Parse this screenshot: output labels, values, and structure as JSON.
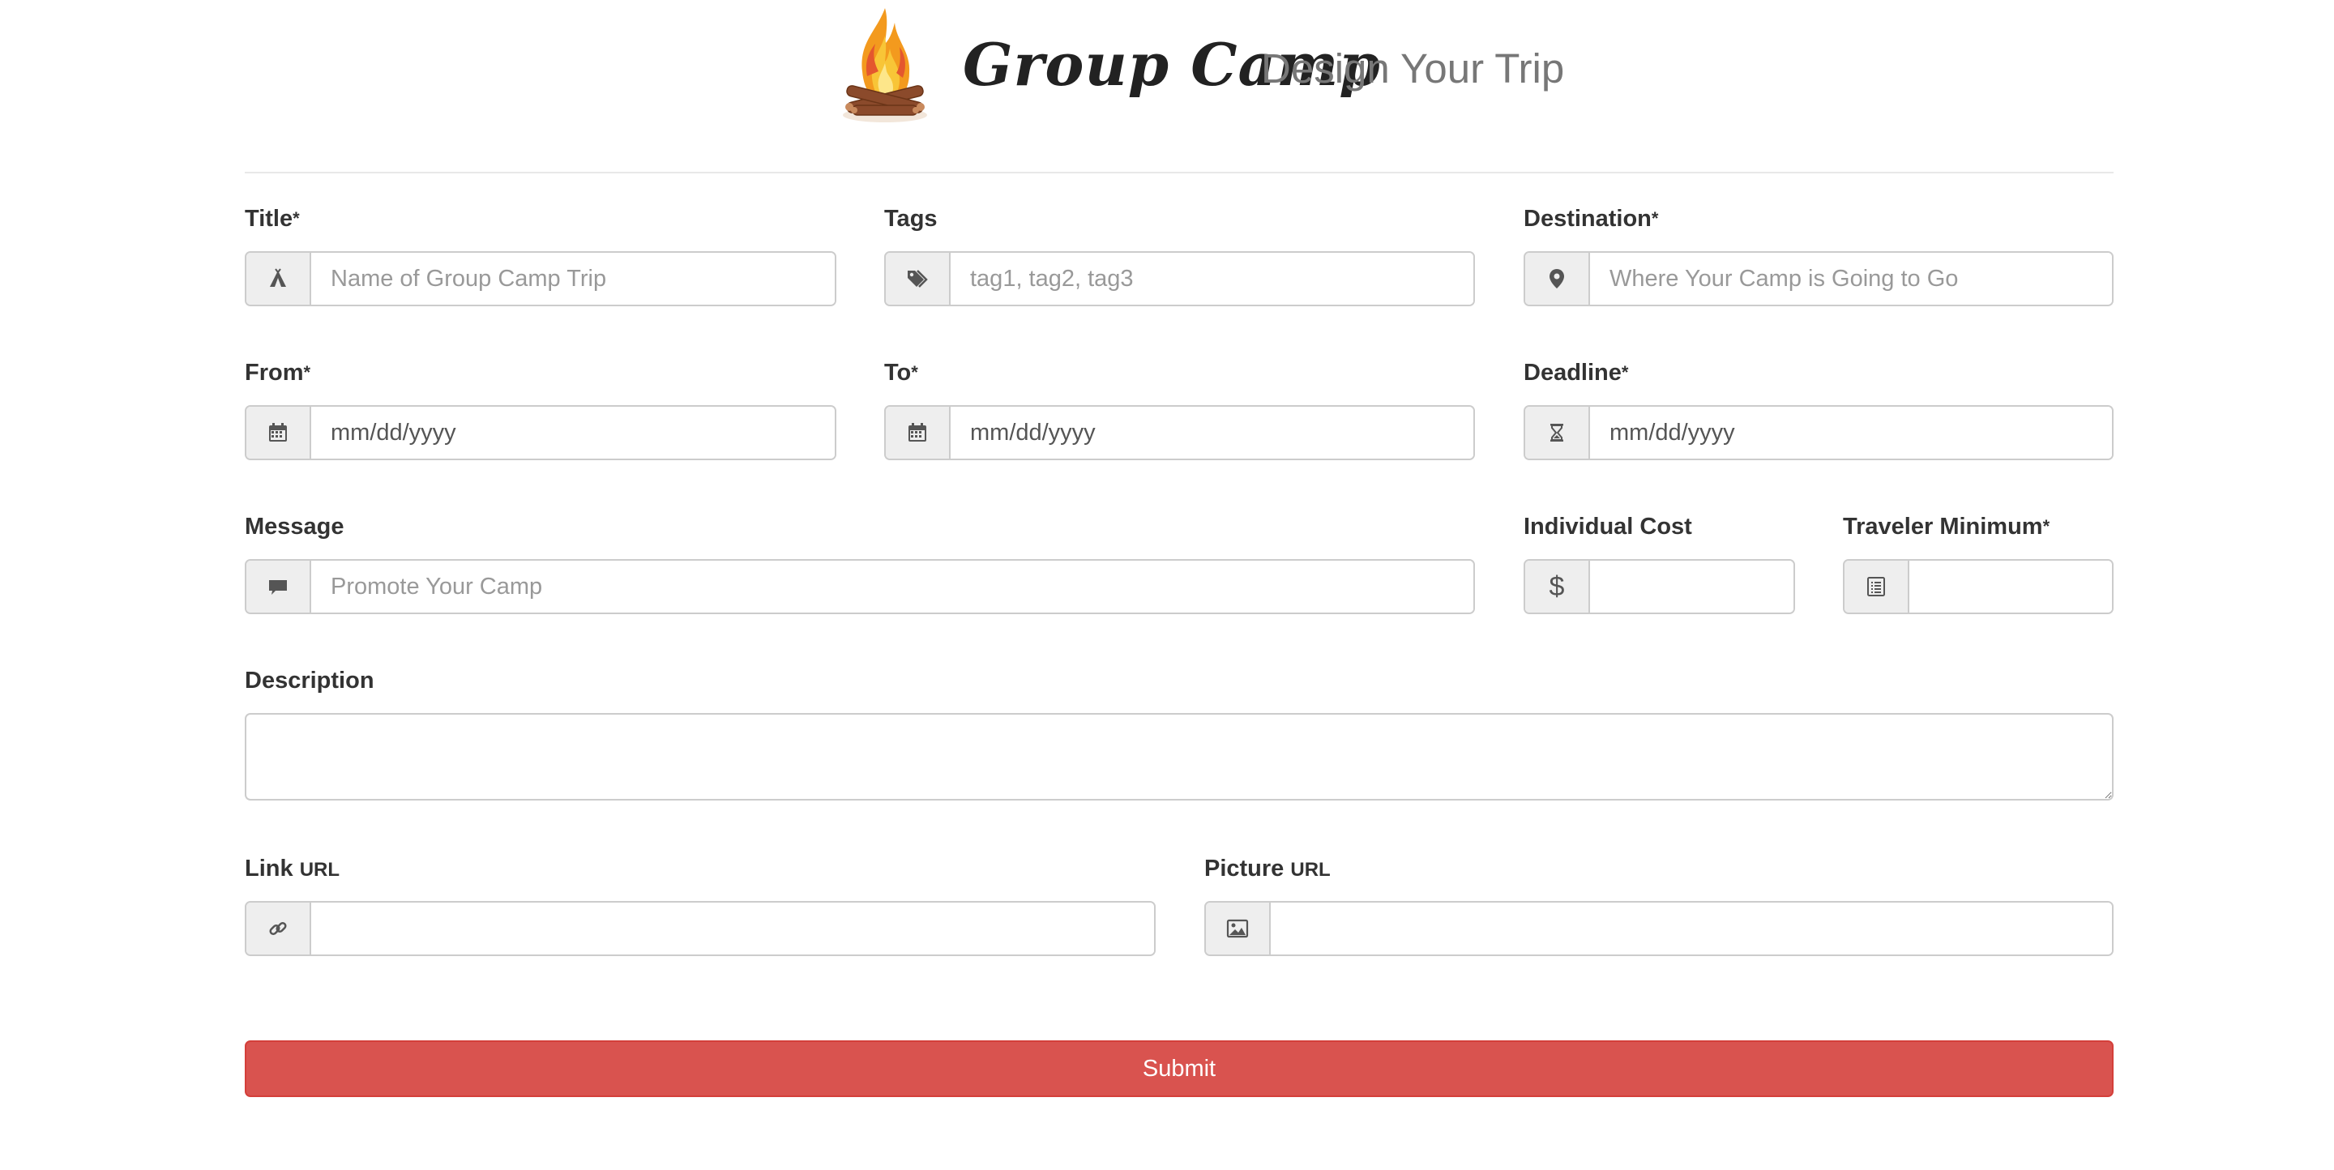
{
  "header": {
    "brand": "Group Camp",
    "tagline": "Design Your Trip"
  },
  "form": {
    "title": {
      "label": "Title",
      "required": "*",
      "placeholder": "Name of Group Camp Trip",
      "icon": "tent-icon"
    },
    "tags": {
      "label": "Tags",
      "placeholder": "tag1, tag2, tag3",
      "icon": "tags-icon"
    },
    "destination": {
      "label": "Destination",
      "required": "*",
      "placeholder": "Where Your Camp is Going to Go",
      "icon": "map-marker-icon"
    },
    "from": {
      "label": "From",
      "required": "*",
      "placeholder": "mm/dd/yyyy",
      "icon": "calendar-icon"
    },
    "to": {
      "label": "To",
      "required": "*",
      "placeholder": "mm/dd/yyyy",
      "icon": "calendar-icon"
    },
    "deadline": {
      "label": "Deadline",
      "required": "*",
      "placeholder": "mm/dd/yyyy",
      "icon": "hourglass-icon"
    },
    "message": {
      "label": "Message",
      "placeholder": "Promote Your Camp",
      "icon": "comment-icon"
    },
    "individual_cost": {
      "label": "Individual Cost",
      "placeholder": "",
      "icon": "dollar-icon",
      "symbol": "$"
    },
    "traveler_minimum": {
      "label": "Traveler Minimum",
      "required": "*",
      "placeholder": "",
      "icon": "list-icon"
    },
    "description": {
      "label": "Description",
      "placeholder": ""
    },
    "link_url": {
      "label": "Link",
      "label_small": "URL",
      "placeholder": "",
      "icon": "link-icon"
    },
    "picture_url": {
      "label": "Picture",
      "label_small": "URL",
      "placeholder": "",
      "icon": "picture-icon"
    },
    "submit_label": "Submit"
  },
  "colors": {
    "submit_bg": "#d9534f",
    "addon_bg": "#eeeeee",
    "border": "#cccccc"
  }
}
